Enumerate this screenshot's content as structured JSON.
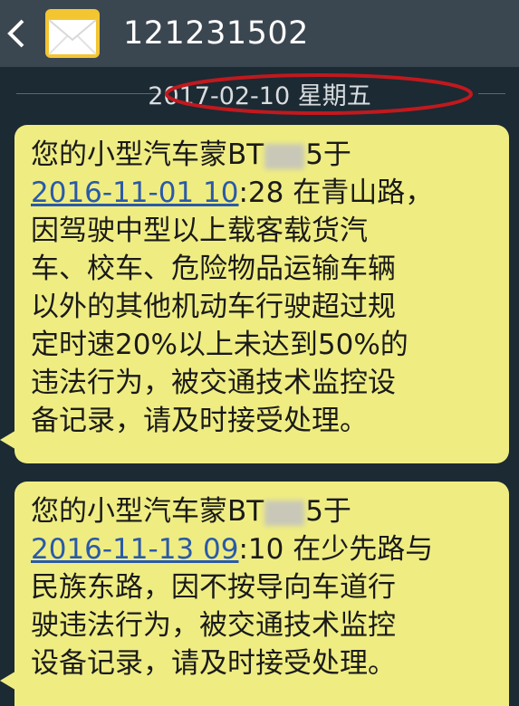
{
  "header": {
    "back_icon": "chevron-left-icon",
    "avatar_icon": "envelope-icon",
    "title": "121231502"
  },
  "date_divider": "2017-02-10 星期五",
  "messages": [
    {
      "l1_pre": "您的小型汽车蒙BT",
      "l1_post": "5于",
      "l2_link": "2016-11-01 10",
      "l2_rest": ":28 在青山路，",
      "l3": "因驾驶中型以上载客载货汽",
      "l4": "车、校车、危险物品运输车辆",
      "l5": "以外的其他机动车行驶超过规",
      "l6": "定时速20%以上未达到50%的",
      "l7": "违法行为，被交通技术监控设",
      "l8": "备记录，请及时接受处理。"
    },
    {
      "l1_pre": "您的小型汽车蒙BT",
      "l1_post": "5于",
      "l2_link": "2016-11-13 09",
      "l2_rest": ":10 在少先路与",
      "l3": "民族东路，因不按导向车道行",
      "l4": "驶违法行为，被交通技术监控",
      "l5": "设备记录，请及时接受处理。"
    }
  ],
  "colors": {
    "bubble": "#efed82",
    "annotation_ellipse": "#c0191e",
    "link": "#2a5aa8"
  }
}
